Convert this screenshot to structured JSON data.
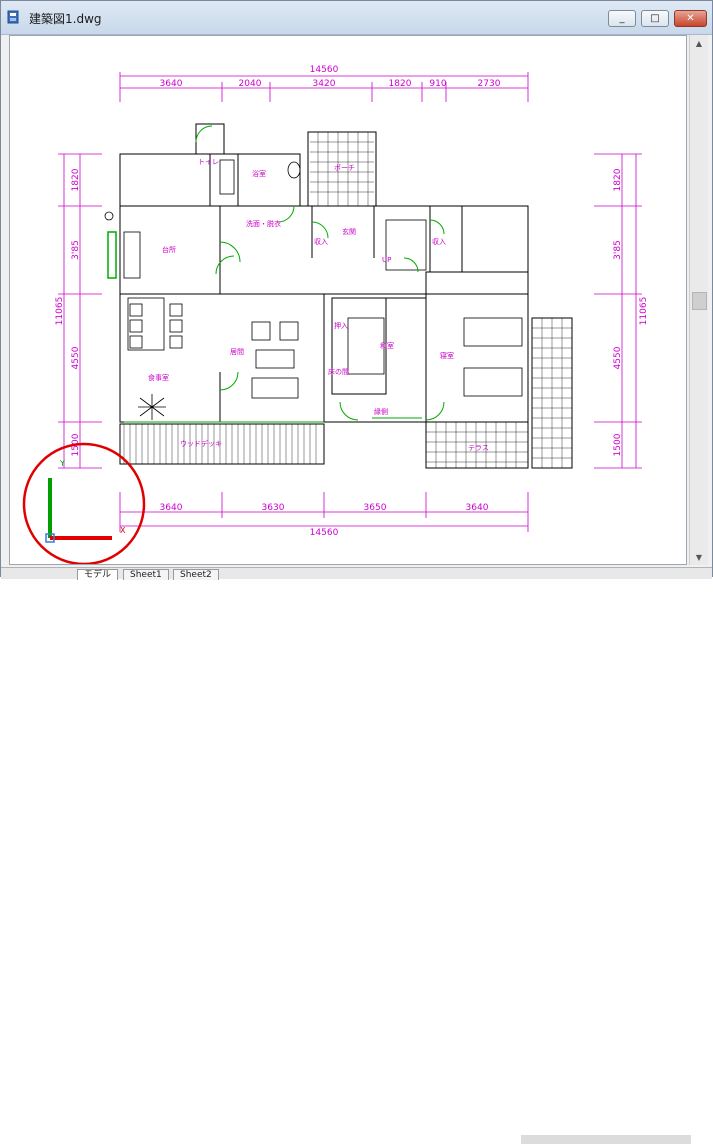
{
  "window": {
    "title": "建築図1.dwg",
    "minimize_label": "_",
    "maximize_label": "□",
    "close_label": "✕"
  },
  "drawing": {
    "top_overall": "14560",
    "top_dims": [
      "3640",
      "2040",
      "3420",
      "1820",
      "910",
      "2730"
    ],
    "bottom_overall": "14560",
    "bottom_dims": [
      "3640",
      "3630",
      "3650",
      "3640"
    ],
    "left_dims": [
      "1820",
      "3'85",
      "11065",
      "4550",
      "1500"
    ],
    "right_dims": [
      "1820",
      "3'85",
      "11065",
      "4550",
      "1500"
    ],
    "rooms": {
      "toilet": "トイレ",
      "bath": "浴室",
      "porch": "ポーチ",
      "washroom": "洗面・脱衣",
      "storage1": "収入",
      "entrance": "玄関",
      "storage2": "収入",
      "kitchen": "台所",
      "living": "居間",
      "dining": "食事室",
      "tatami": "和室",
      "closet": "押入",
      "alcove": "床の間",
      "bedroom": "寝室",
      "engawa": "縁側",
      "deck": "ウッドデッキ",
      "terrace": "テラス",
      "up_label": "UP"
    }
  },
  "ucs": {
    "x_axis": "X",
    "y_axis": "Y"
  },
  "tabs": [
    "モデル",
    "Sheet1",
    "Sheet2"
  ],
  "colors": {
    "dimension": "#cc00cc",
    "wall": "#000000",
    "door": "#00aa00",
    "ucs_x": "#e00000",
    "ucs_y": "#00a000",
    "highlight_circle": "#e00000"
  }
}
